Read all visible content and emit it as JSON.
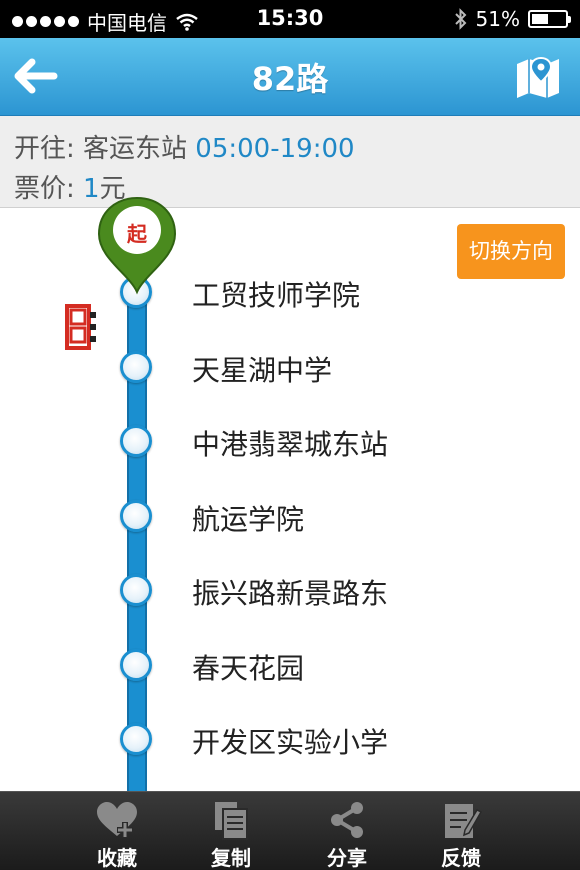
{
  "status_bar": {
    "carrier": "中国电信",
    "time": "15:30",
    "battery_text": "51%",
    "battery_level": 0.51
  },
  "header": {
    "title": "82路",
    "back_icon": "back-arrow-icon",
    "map_icon": "map-icon"
  },
  "info": {
    "direction_label": "开往: 客运东站",
    "hours": "05:00-19:00",
    "fare_label": "票价: ",
    "fare_value": "1",
    "fare_unit": "元"
  },
  "route": {
    "start_marker": "起",
    "switch_label": "切换方向",
    "stops": [
      "工贸技师学院",
      "天星湖中学",
      "中港翡翠城东站",
      "航运学院",
      "振兴路新景路东",
      "春天花园",
      "开发区实验小学"
    ],
    "line_color": "#1a8fd0",
    "pin_color": "#4a8a1e",
    "bus_color": "#d42c22"
  },
  "tabbar": {
    "items": [
      {
        "label": "收藏",
        "icon": "heart-plus-icon"
      },
      {
        "label": "复制",
        "icon": "copy-icon"
      },
      {
        "label": "分享",
        "icon": "share-icon"
      },
      {
        "label": "反馈",
        "icon": "feedback-icon"
      }
    ]
  }
}
